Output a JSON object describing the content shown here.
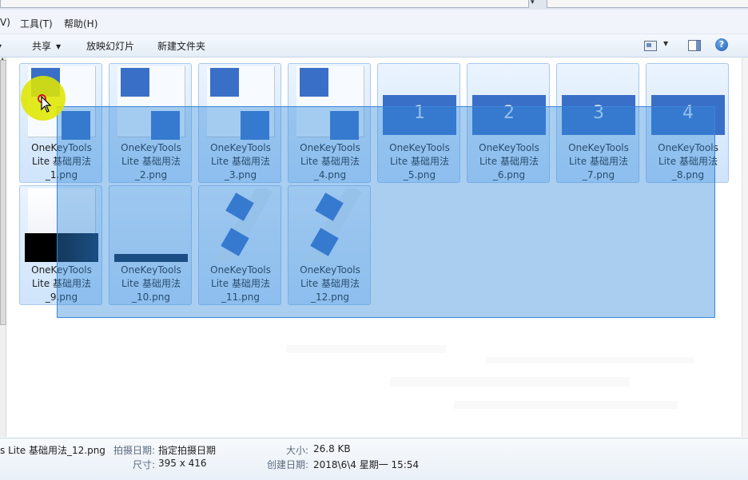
{
  "menu": {
    "view_partial": "V)",
    "tools": "工具(T)",
    "help": "帮助(H)"
  },
  "toolbar": {
    "share": "共享",
    "slideshow": "放映幻灯片",
    "new_folder": "新建文件夹"
  },
  "files": [
    {
      "name_line1": "OneKeyTools",
      "name_line2": "Lite 基础用法",
      "name_line3": "_1.png",
      "thumb": "two-squares"
    },
    {
      "name_line1": "OneKeyTools",
      "name_line2": "Lite 基础用法",
      "name_line3": "_2.png",
      "thumb": "two-squares"
    },
    {
      "name_line1": "OneKeyTools",
      "name_line2": "Lite 基础用法",
      "name_line3": "_3.png",
      "thumb": "two-squares"
    },
    {
      "name_line1": "OneKeyTools",
      "name_line2": "Lite 基础用法",
      "name_line3": "_4.png",
      "thumb": "two-squares"
    },
    {
      "name_line1": "OneKeyTools",
      "name_line2": "Lite 基础用法",
      "name_line3": "_5.png",
      "thumb": "numbered-slide",
      "slide_number": "1"
    },
    {
      "name_line1": "OneKeyTools",
      "name_line2": "Lite 基础用法",
      "name_line3": "_6.png",
      "thumb": "numbered-slide",
      "slide_number": "2"
    },
    {
      "name_line1": "OneKeyTools",
      "name_line2": "Lite 基础用法",
      "name_line3": "_7.png",
      "thumb": "numbered-slide",
      "slide_number": "3"
    },
    {
      "name_line1": "OneKeyTools",
      "name_line2": "Lite 基础用法",
      "name_line3": "_8.png",
      "thumb": "numbered-slide",
      "slide_number": "4"
    },
    {
      "name_line1": "OneKeyTools",
      "name_line2": "Lite 基础用法",
      "name_line3": "_9.png",
      "thumb": "gradient-bar"
    },
    {
      "name_line1": "OneKeyTools",
      "name_line2": "Lite 基础用法",
      "name_line3": "_10.png",
      "thumb": "thin-bar"
    },
    {
      "name_line1": "OneKeyTools",
      "name_line2": "Lite 基础用法",
      "name_line3": "_11.png",
      "thumb": "rotated-squares"
    },
    {
      "name_line1": "OneKeyTools",
      "name_line2": "Lite 基础用法",
      "name_line3": "_12.png",
      "thumb": "rotated-squares"
    }
  ],
  "details": {
    "filename": "s Lite 基础用法_12.png",
    "date_taken_label": "拍摄日期:",
    "date_taken_value": "指定拍摄日期",
    "dimensions_label": "尺寸:",
    "dimensions_value": "395 x 416",
    "size_label": "大小:",
    "size_value": "26.8 KB",
    "created_label": "创建日期:",
    "created_value": "2018\\6\\4 星期一 15:54"
  },
  "icons": [
    "view-options-icon",
    "preview-pane-icon",
    "help-icon"
  ],
  "colors": {
    "accent": "#3a6fc8",
    "selection": "#338bdb",
    "cursor_highlight": "#dfe600"
  }
}
